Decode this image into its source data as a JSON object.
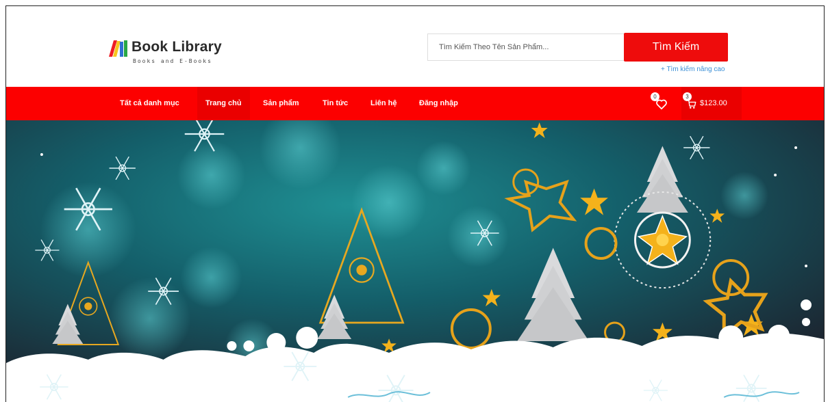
{
  "brand": {
    "title": "Book Library",
    "subtitle": "Books and E-Books",
    "logo_icon": "books-logo-icon",
    "colors": {
      "mark_red": "#ee1c24",
      "mark_yellow": "#f7c51e",
      "mark_blue": "#2e6fd0",
      "mark_green": "#28a745"
    }
  },
  "search": {
    "placeholder": "Tìm Kiếm Theo Tên Sản Phẩm...",
    "button_label": "Tìm Kiếm",
    "advanced_link": "+ Tìm kiếm nâng cao"
  },
  "nav": {
    "items": [
      {
        "label": "Tất cả danh mục",
        "active": false
      },
      {
        "label": "Trang chủ",
        "active": true
      },
      {
        "label": "Sản phẩm",
        "active": false
      },
      {
        "label": "Tin tức",
        "active": false
      },
      {
        "label": "Liên hệ",
        "active": false
      },
      {
        "label": "Đăng nhập",
        "active": false
      }
    ],
    "wishlist": {
      "icon": "heart-icon",
      "count": "0"
    },
    "cart": {
      "icon": "cart-icon",
      "count": "3",
      "total": "$123.00"
    }
  },
  "banner": {
    "image": "christmas-banner",
    "alt": "Christmas trees, snowflakes and stars illustration"
  },
  "theme": {
    "primary": "#fc0000",
    "primary_dark": "#ea0000",
    "link": "#3b8fd6"
  }
}
